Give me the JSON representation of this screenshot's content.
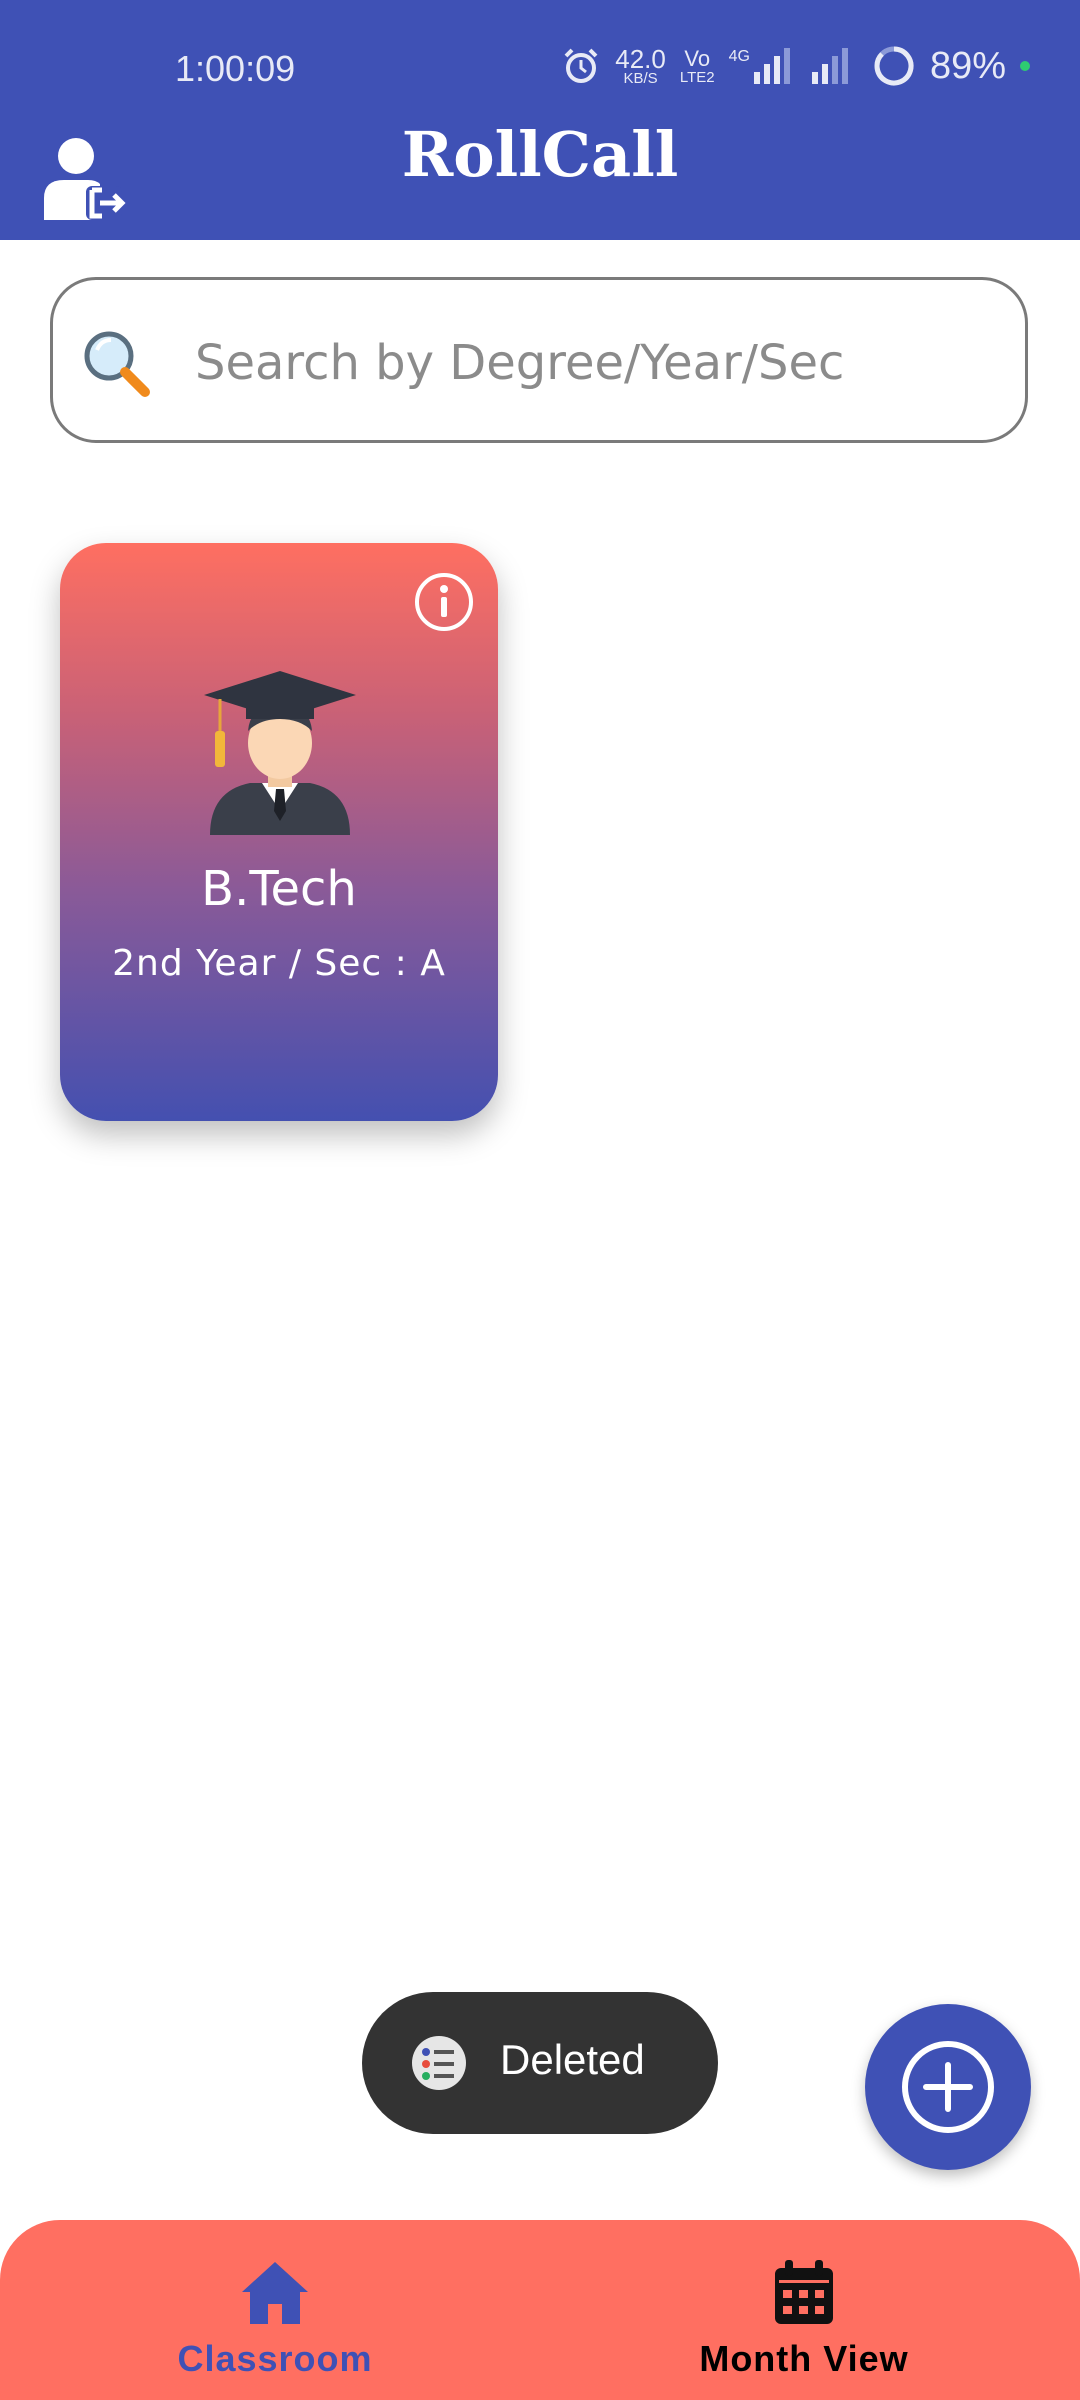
{
  "status_bar": {
    "time": "1:00:09",
    "net_speed_value": "42.0",
    "net_speed_unit": "KB/S",
    "volte_top": "Vo",
    "volte_bottom": "LTE2",
    "network_type": "4G",
    "battery": "89%",
    "icons": [
      "alarm-icon",
      "signal-icon",
      "battery-icon"
    ]
  },
  "app_bar": {
    "title": "RollCall",
    "logout_icon": "logout-user-icon"
  },
  "search": {
    "placeholder": "Search by Degree/Year/Sec",
    "value": "",
    "icon": "search-icon"
  },
  "classes": [
    {
      "degree": "B.Tech",
      "subtitle": "2nd Year / Sec : A",
      "icon": "graduate-avatar-icon",
      "info_icon": "info-icon"
    }
  ],
  "toast": {
    "message": "Deleted",
    "icon": "app-icon"
  },
  "fab": {
    "icon": "add-circle-icon"
  },
  "bottom_nav": {
    "items": [
      {
        "label": "Classroom",
        "icon": "home-icon",
        "active": true
      },
      {
        "label": "Month View",
        "icon": "calendar-icon",
        "active": false
      }
    ]
  },
  "colors": {
    "primary": "#3f51b5",
    "accent": "#ff6f61",
    "toast_bg": "#333333",
    "nav_active": "#3f51b5",
    "nav_inactive": "#000000"
  }
}
